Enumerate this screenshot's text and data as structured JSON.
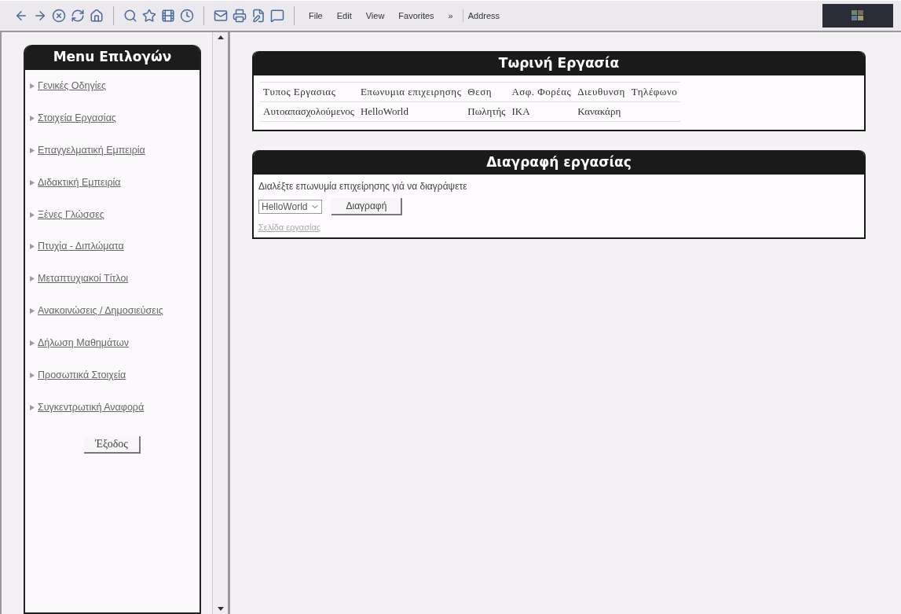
{
  "toolbar": {
    "menus": [
      "File",
      "Edit",
      "View",
      "Favorites"
    ],
    "chevron": "»",
    "address_label": "Address"
  },
  "sidebar": {
    "title": "Menu Επιλογών",
    "items": [
      {
        "label": "Γενικές Οδηγίες"
      },
      {
        "label": "Στοιχεία Εργασίας"
      },
      {
        "label": "Επαγγελματική Εμπειρία"
      },
      {
        "label": "Διδακτική Εμπειρία"
      },
      {
        "label": "Ξένες Γλώσσες"
      },
      {
        "label": "Πτυχία - Διπλώματα"
      },
      {
        "label": "Μεταπτυχιακοί Τίτλοι"
      },
      {
        "label": "Ανακοινώσεις / Δημοσιεύσεις"
      },
      {
        "label": "Δήλωση Μαθημάτων"
      },
      {
        "label": "Προσωπικά Στοιχεία"
      },
      {
        "label": "Συγκεντρωτική Αναφορά"
      }
    ],
    "exit_button": "Έξοδος"
  },
  "current_job": {
    "title": "Τωρινή Εργασία",
    "columns": [
      "Τυπος Εργασιας",
      "Επωνυμια επιχειρησης",
      "Θεση",
      "Ασφ. Φορέας",
      "Διευθυνση",
      "Τηλέφωνο"
    ],
    "rows": [
      [
        "Αυτοαπασχολούμενος",
        "HelloWorld",
        "Πωλητής",
        "ΙΚΑ",
        "Κανακάρη"
      ]
    ]
  },
  "delete_job": {
    "title": "Διαγραφή εργασίας",
    "prompt": "Διαλέξτε επωνυμία επιχείρησης γιά να διαγράψετε",
    "select_value": "HelloWorld",
    "button": "Διαγραφή",
    "link": "Σελίδα εργασίας"
  }
}
